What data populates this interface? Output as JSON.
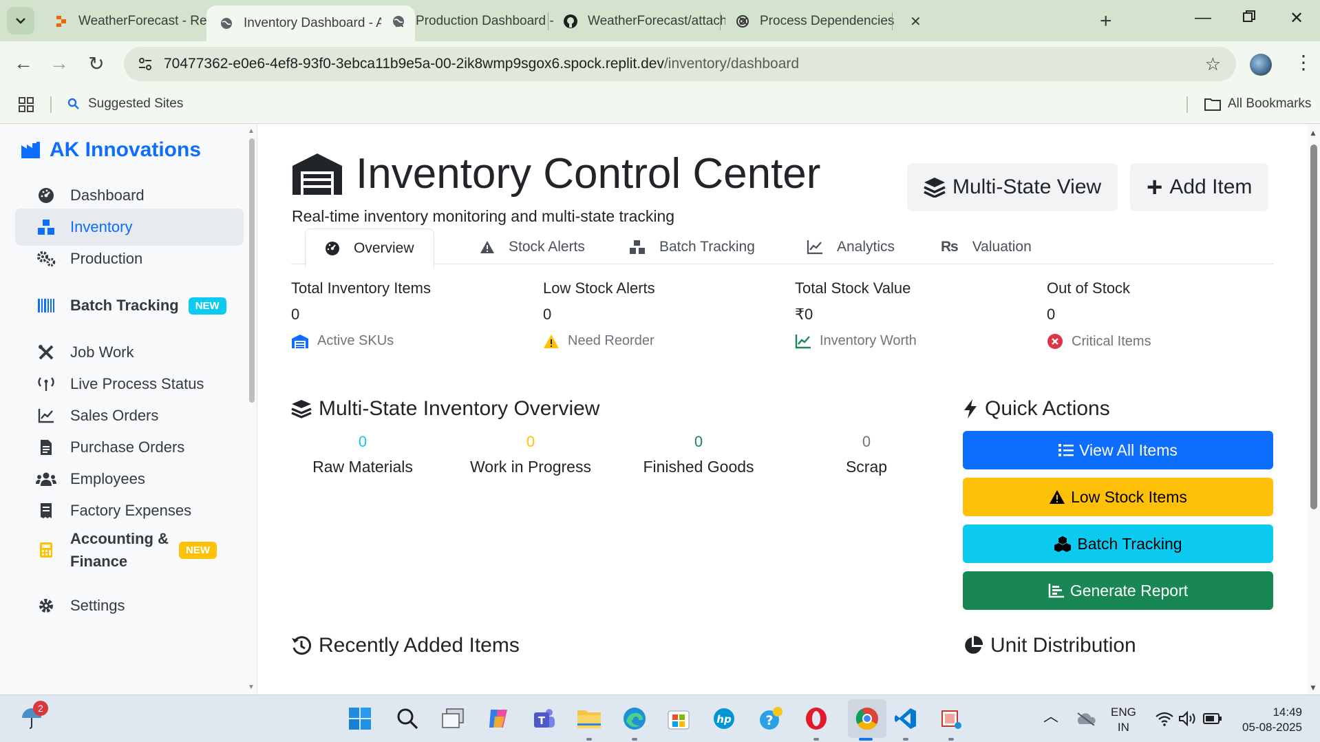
{
  "browser": {
    "tabs": [
      {
        "title": "WeatherForecast - Replit",
        "icon": "replit-icon"
      },
      {
        "title": "Inventory Dashboard - AI",
        "icon": "globe-icon"
      },
      {
        "title": "Production Dashboard - I",
        "icon": "globe-icon"
      },
      {
        "title": "WeatherForecast/attache",
        "icon": "github-icon"
      },
      {
        "title": "Process Dependencies O",
        "icon": "openai-icon"
      }
    ],
    "active_tab_index": 1,
    "url_host": "70477362-e0e6-4ef8-93f0-3ebca11b9e5a-00-2ik8wmp9sgox6.spock.replit.dev",
    "url_path": "/inventory/dashboard",
    "bookmarks": {
      "suggested": "Suggested Sites",
      "all": "All Bookmarks"
    }
  },
  "sidebar": {
    "brand": "AK Innovations",
    "items": [
      {
        "label": "Dashboard",
        "icon": "gauge-icon"
      },
      {
        "label": "Inventory",
        "icon": "boxes-icon",
        "active": true
      },
      {
        "label": "Production",
        "icon": "gears-icon"
      },
      {
        "label": "Batch Tracking",
        "icon": "barcode-icon",
        "badge": "NEW"
      },
      {
        "label": "Job Work",
        "icon": "tools-icon"
      },
      {
        "label": "Live Process Status",
        "icon": "broadcast-icon"
      },
      {
        "label": "Sales Orders",
        "icon": "chart-line-icon"
      },
      {
        "label": "Purchase Orders",
        "icon": "file-icon"
      },
      {
        "label": "Employees",
        "icon": "users-icon"
      },
      {
        "label": "Factory Expenses",
        "icon": "receipt-icon"
      },
      {
        "label": "Accounting &",
        "label2": "Finance",
        "icon": "calculator-icon",
        "badge": "NEW"
      },
      {
        "label": "Settings",
        "icon": "gear-icon"
      }
    ]
  },
  "header": {
    "title": "Inventory Control Center",
    "subtitle": "Real-time inventory monitoring and multi-state tracking",
    "multi_state_btn": "Multi-State View",
    "add_item_btn": "Add Item"
  },
  "tabs": [
    "Overview",
    "Stock Alerts",
    "Batch Tracking",
    "Analytics",
    "Valuation"
  ],
  "stats": [
    {
      "label": "Total Inventory Items",
      "value": "0",
      "footer": "Active SKUs",
      "color": "#0d6efd"
    },
    {
      "label": "Low Stock Alerts",
      "value": "0",
      "footer": "Need Reorder",
      "color": "#ffc107"
    },
    {
      "label": "Total Stock Value",
      "value": "₹0",
      "footer": "Inventory Worth",
      "color": "#198754"
    },
    {
      "label": "Out of Stock",
      "value": "0",
      "footer": "Critical Items",
      "color": "#dc3545"
    }
  ],
  "multi_state": {
    "title": "Multi-State Inventory Overview",
    "states": [
      {
        "value": "0",
        "label": "Raw Materials",
        "color": "#0dcaf0"
      },
      {
        "value": "0",
        "label": "Work in Progress",
        "color": "#ffc107"
      },
      {
        "value": "0",
        "label": "Finished Goods",
        "color": "#198754"
      },
      {
        "value": "0",
        "label": "Scrap",
        "color": "#6c757d"
      }
    ]
  },
  "quick_actions": {
    "title": "Quick Actions",
    "buttons": [
      {
        "label": "View All Items",
        "bg": "#0d6efd",
        "fg": "#ffffff"
      },
      {
        "label": "Low Stock Items",
        "bg": "#ffc107",
        "fg": "#000000"
      },
      {
        "label": "Batch Tracking",
        "bg": "#0dcaf0",
        "fg": "#000000"
      },
      {
        "label": "Generate Report",
        "bg": "#198754",
        "fg": "#ffffff"
      }
    ]
  },
  "recent": {
    "title": "Recently Added Items"
  },
  "unit_dist": {
    "title": "Unit Distribution"
  },
  "taskbar": {
    "weather_badge": "2",
    "lang": "ENG",
    "region": "IN",
    "time": "14:49",
    "date": "05-08-2025"
  }
}
